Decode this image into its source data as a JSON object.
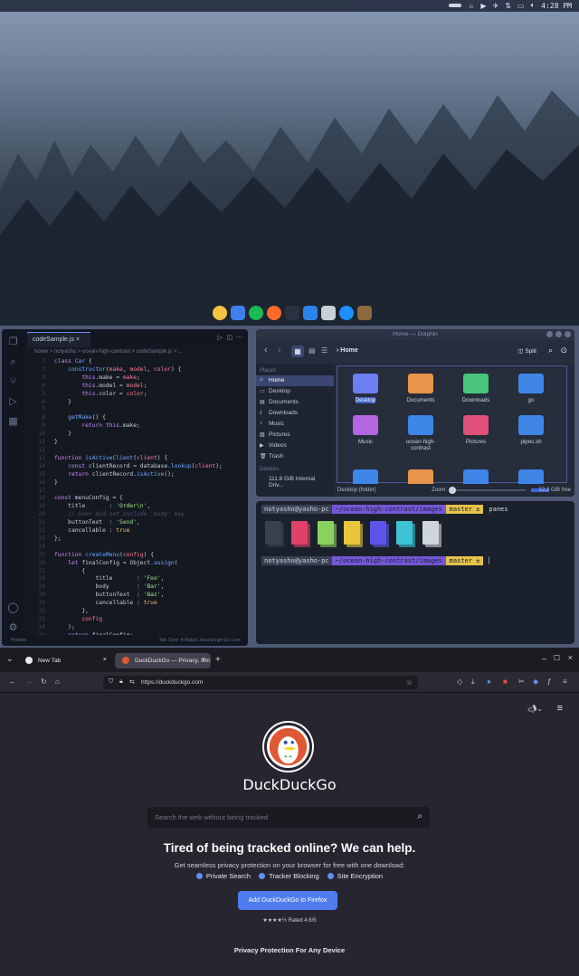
{
  "topbar": {
    "clock": "4:28 PM"
  },
  "dock": {
    "apps": [
      "pidgin-icon",
      "files-icon",
      "spotify-icon",
      "firefox-icon",
      "terminal-icon",
      "vscode-icon",
      "blender-icon",
      "messenger-icon",
      "gimp-icon"
    ],
    "colors": [
      "#f5c542",
      "#3e7ff0",
      "#1db954",
      "#ff6a2a",
      "#2c3140",
      "#2b84ea",
      "#c9cfd9",
      "#1e8fff",
      "#8c6a3e"
    ]
  },
  "editor": {
    "tab": "codeSample.js",
    "breadcrumb": "home > notyasho > ocean-high-contrast > codeSample.js > ...",
    "line_numbers": "1\n2\n3\n4\n5\n6\n7\n8\n9\n10\n11\n12\n13\n14\n15\n16\n17\n18\n19\n20\n21\n22\n23\n24\n25\n26\n27\n28\n29\n30\n31\n32\n33\n34\n35\n36\n37\n38\n39\n40\n41\n42\n43",
    "status_left": "Prettier",
    "status_right": "Tab Size: 4   Babel JavaScript   Go Live"
  },
  "dolphin": {
    "title": "Home — Dolphin",
    "location": "Home",
    "split": "Split",
    "places_header": "Places",
    "places": [
      "Home",
      "Desktop",
      "Documents",
      "Downloads",
      "Music",
      "Pictures",
      "Videos",
      "Trash"
    ],
    "devices_header": "Devices",
    "device": "111.8 GiB Internal Driv...",
    "files": [
      {
        "name": "Desktop",
        "color": "#6d7ef2"
      },
      {
        "name": "Documents",
        "color": "#e8944a"
      },
      {
        "name": "Downloads",
        "color": "#48c57a"
      },
      {
        "name": "go",
        "color": "#3e86e8"
      },
      {
        "name": "Music",
        "color": "#b466e0"
      },
      {
        "name": "ocean-high-contrast",
        "color": "#3e86e8"
      },
      {
        "name": "Pictures",
        "color": "#e0507a"
      },
      {
        "name": "pipes.sh",
        "color": "#3e86e8"
      }
    ],
    "status_left": "Desktop (folder)",
    "zoom": "Zoom:",
    "free": "52.2 GiB free"
  },
  "terminal": {
    "user": "notyasho@yasho-pc",
    "path": "~/ocean-high-contrast/images",
    "branch": "master ±",
    "cmd": "panes",
    "swatch_colors": [
      "#3a404e",
      "#e0406a",
      "#8bd15e",
      "#e8c63c",
      "#5c55e8",
      "#3cc4d6",
      "#d0d4dc"
    ]
  },
  "firefox": {
    "tabs": [
      {
        "label": "New Tab"
      },
      {
        "label": "DuckDuckGo — Privacy, sim"
      }
    ],
    "url": "https://duckduckgo.com",
    "brand": "DuckDuckGo",
    "search_placeholder": "Search the web without being tracked",
    "headline": "Tired of being tracked online? We can help.",
    "subline": "Get seamless privacy protection on your browser for free with one download:",
    "features": [
      "Private Search",
      "Tracker Blocking",
      "Site Encryption"
    ],
    "cta": "Add DuckDuckGo to Firefox",
    "rating": "★★★★½   Rated 4.6/5",
    "footer": "Privacy Protection For Any Device"
  }
}
